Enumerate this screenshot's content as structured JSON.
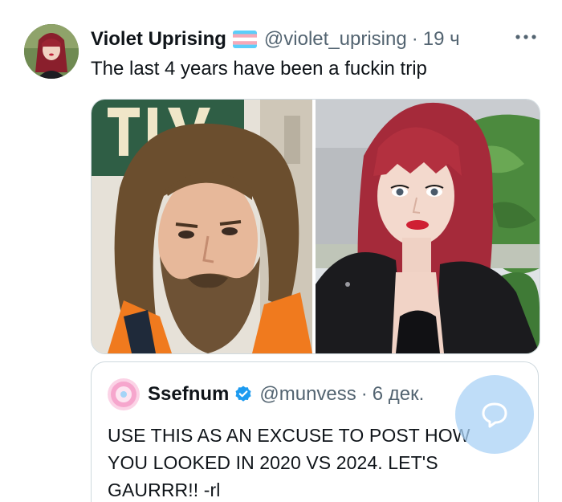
{
  "tweet": {
    "display_name": "Violet Uprising",
    "handle": "@violet_uprising",
    "separator": "·",
    "time": "19 ч",
    "text": "The last 4 years have been a fuckin trip",
    "flag_icon": "trans-flag-icon",
    "more_icon": "more-dots-icon"
  },
  "quote": {
    "display_name": "Ssefnum",
    "handle": "@munvess",
    "separator": "·",
    "time": "6 дек.",
    "text": "USE THIS AS AN EXCUSE TO POST HOW YOU LOOKED IN 2020 VS 2024. LET'S GAURRR!! -rl",
    "verified_icon": "verified-badge-icon"
  },
  "colors": {
    "text": "#0f1419",
    "muted": "#536471",
    "border": "#cfd9de",
    "verified": "#1d9bf0",
    "fab": "#aad2f5"
  }
}
